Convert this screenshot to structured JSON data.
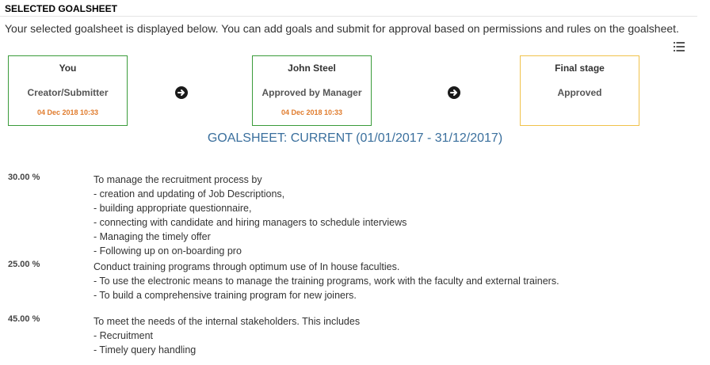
{
  "header": {
    "section_title": "SELECTED GOALSHEET",
    "intro": "Your selected goalsheet is displayed below. You can add goals and submit for approval based on permissions and rules on the goalsheet."
  },
  "workflow": {
    "stages": [
      {
        "name": "You",
        "status": "Creator/Submitter",
        "date": "04 Dec 2018 10:33",
        "border_color": "#3a9b3a"
      },
      {
        "name": "John Steel",
        "status": "Approved by Manager",
        "date": "04 Dec 2018 10:33",
        "border_color": "#3a9b3a"
      },
      {
        "name": "Final stage",
        "status": "Approved",
        "date": "",
        "border_color": "#f0c24b"
      }
    ],
    "arrow_icon": "arrow-circle-right-icon",
    "menu_icon": "list-icon"
  },
  "goalsheet": {
    "heading": "GOALSHEET: CURRENT (01/01/2017 - 31/12/2017)",
    "goals": [
      {
        "weight": "30.00 %",
        "lines": [
          "To manage the recruitment process by",
          "- creation and updating of Job Descriptions,",
          "- building appropriate questionnaire,",
          "- connecting with candidate and hiring managers to schedule interviews",
          "- Managing the timely offer",
          "- Following up on on-boarding pro"
        ]
      },
      {
        "weight": "25.00 %",
        "lines": [
          "Conduct training programs through optimum use of In house faculties.",
          "- To use the electronic means to manage the training programs, work with the faculty and external trainers.",
          "- To build a comprehensive training program for new joiners."
        ]
      },
      {
        "weight": "45.00 %",
        "lines": [
          "To meet the needs of the internal stakeholders. This includes",
          "- Recruitment",
          "- Timely query handling"
        ]
      }
    ]
  },
  "colors": {
    "heading_blue": "#3a6f9d",
    "date_orange": "#e07b2c",
    "approved_green": "#3a9b3a",
    "pending_yellow": "#f0c24b"
  }
}
